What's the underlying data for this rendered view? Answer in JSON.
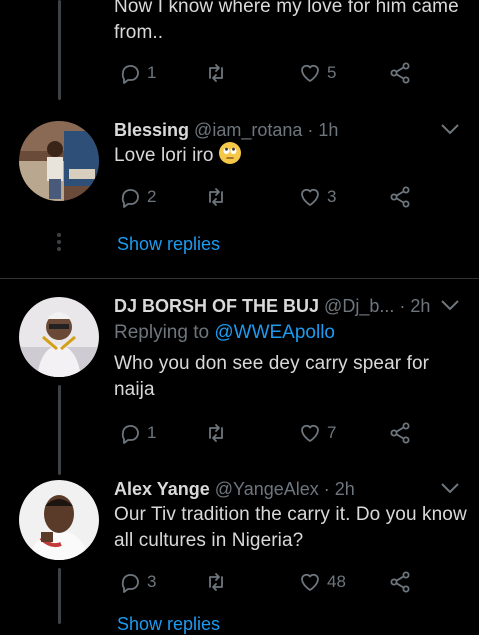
{
  "colors": {
    "background": "#000000",
    "text": "#d9d9d9",
    "muted": "#6e767d",
    "accent": "#1d9bf0"
  },
  "top_tweet": {
    "text_lines": [
      "Now I know where my love for him came",
      "from.."
    ],
    "replies": "1",
    "likes": "5"
  },
  "tweet_blessing": {
    "name": "Blessing",
    "handle": "@iam_rotana",
    "sep": "·",
    "time": "1h",
    "text": "Love lori iro",
    "emoji_icon": "face-with-rolling-eyes",
    "replies": "2",
    "likes": "3"
  },
  "show_replies_label": "Show replies",
  "tweet_djborsh": {
    "name": "DJ BORSH OF THE BUJ",
    "handle": "@Dj_b...",
    "sep": "·",
    "time": "2h",
    "replying_prefix": "Replying to",
    "replying_handle": "@WWEApollo",
    "text_lines": [
      "Who you don see dey carry spear for",
      "naija"
    ],
    "replies": "1",
    "likes": "7"
  },
  "tweet_alex": {
    "name": "Alex Yange",
    "handle": "@YangeAlex",
    "sep": "·",
    "time": "2h",
    "text_lines": [
      "Our Tiv tradition the carry it. Do you know",
      "all cultures in Nigeria?"
    ],
    "replies": "3",
    "likes": "48"
  },
  "bottom_partial_label": "Show replies"
}
